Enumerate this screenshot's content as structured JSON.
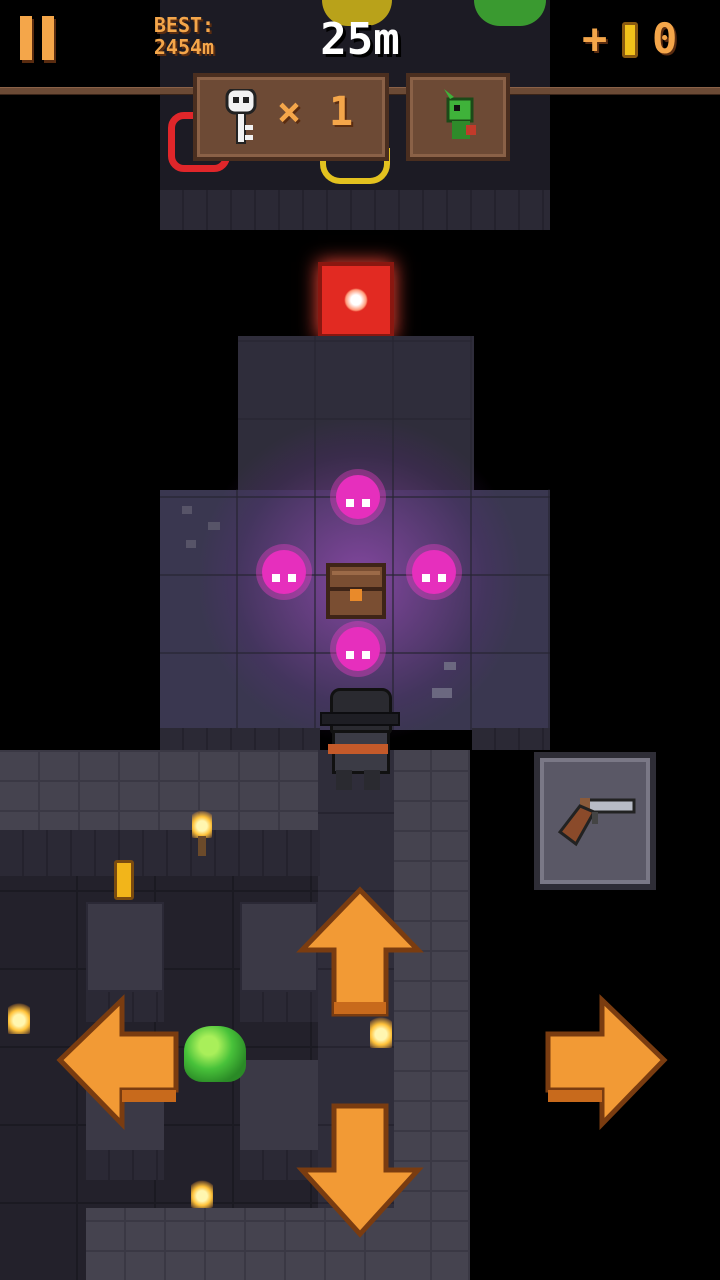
{
  "hud": {
    "best_label": "BEST:",
    "best_value": "2454m",
    "distance": "25m",
    "coins_prefix": "+",
    "coins": "0",
    "keys_prefix": "×",
    "keys_count": "1"
  },
  "icons": {
    "pause": "pause-icon",
    "coin": "coin-icon",
    "skull_key": "skull-key-icon",
    "pet": "green-dragon-icon",
    "weapon": "flintlock-pistol-icon",
    "move_up": "arrow-up-icon",
    "move_down": "arrow-down-icon",
    "move_left": "arrow-left-icon",
    "move_right": "arrow-right-icon"
  },
  "colors": {
    "accent": "#f4a64a",
    "ghost": "#ff3fd0",
    "panel": "#6d4a35",
    "arrow": "#f29a35"
  }
}
